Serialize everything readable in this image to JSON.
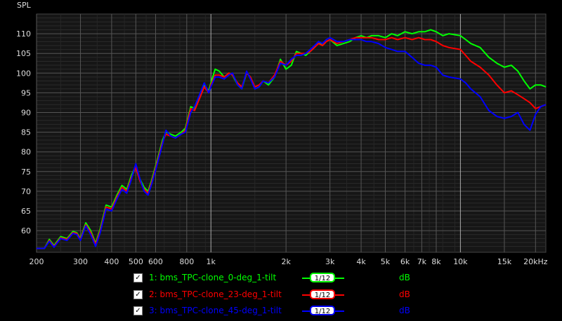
{
  "chart_data": {
    "type": "line",
    "ylabel": "SPL",
    "xlabel": "",
    "xscale": "log",
    "xlim": [
      200,
      22000
    ],
    "ylim": [
      54.5,
      115
    ],
    "yticks": [
      60,
      65,
      70,
      75,
      80,
      85,
      90,
      95,
      100,
      105,
      110
    ],
    "xticks": [
      {
        "v": 200,
        "label": "200"
      },
      {
        "v": 300,
        "label": "300"
      },
      {
        "v": 400,
        "label": "400"
      },
      {
        "v": 500,
        "label": "500"
      },
      {
        "v": 600,
        "label": "600"
      },
      {
        "v": 800,
        "label": "800"
      },
      {
        "v": 1000,
        "label": "1k"
      },
      {
        "v": 2000,
        "label": "2k"
      },
      {
        "v": 3000,
        "label": "3k"
      },
      {
        "v": 4000,
        "label": "4k"
      },
      {
        "v": 5000,
        "label": "5k"
      },
      {
        "v": 6000,
        "label": "6k"
      },
      {
        "v": 7000,
        "label": "7k"
      },
      {
        "v": 8000,
        "label": "8k"
      },
      {
        "v": 10000,
        "label": "10k"
      },
      {
        "v": 15000,
        "label": "15k"
      },
      {
        "v": 20000,
        "label": "20kHz"
      }
    ],
    "grid": true,
    "series": [
      {
        "name": "1: bms_TPC-clone_0-deg_1-tilt",
        "color": "#00ff00",
        "points": [
          [
            200,
            55.5
          ],
          [
            215,
            55.5
          ],
          [
            225,
            57.8
          ],
          [
            235,
            56.2
          ],
          [
            250,
            58.5
          ],
          [
            265,
            58.0
          ],
          [
            280,
            59.8
          ],
          [
            290,
            59.5
          ],
          [
            300,
            58.0
          ],
          [
            315,
            62.0
          ],
          [
            330,
            60.0
          ],
          [
            345,
            56.8
          ],
          [
            360,
            60.5
          ],
          [
            380,
            66.5
          ],
          [
            400,
            66.0
          ],
          [
            420,
            69.0
          ],
          [
            440,
            71.5
          ],
          [
            460,
            70.5
          ],
          [
            480,
            74.0
          ],
          [
            500,
            76.5
          ],
          [
            520,
            73.0
          ],
          [
            540,
            71.0
          ],
          [
            560,
            70.0
          ],
          [
            580,
            73.0
          ],
          [
            610,
            78.0
          ],
          [
            640,
            83.0
          ],
          [
            660,
            85.0
          ],
          [
            690,
            84.5
          ],
          [
            720,
            84.0
          ],
          [
            760,
            85.0
          ],
          [
            790,
            86.0
          ],
          [
            830,
            91.5
          ],
          [
            860,
            91.0
          ],
          [
            900,
            94.0
          ],
          [
            940,
            97.0
          ],
          [
            980,
            95.5
          ],
          [
            1000,
            97.5
          ],
          [
            1040,
            101.0
          ],
          [
            1080,
            100.5
          ],
          [
            1130,
            99.0
          ],
          [
            1180,
            100.0
          ],
          [
            1220,
            99.5
          ],
          [
            1280,
            97.0
          ],
          [
            1330,
            96.0
          ],
          [
            1390,
            100.0
          ],
          [
            1440,
            99.0
          ],
          [
            1500,
            96.0
          ],
          [
            1560,
            96.5
          ],
          [
            1620,
            98.0
          ],
          [
            1700,
            97.0
          ],
          [
            1800,
            99.0
          ],
          [
            1900,
            103.5
          ],
          [
            2000,
            101.0
          ],
          [
            2100,
            102.0
          ],
          [
            2200,
            105.5
          ],
          [
            2300,
            105.0
          ],
          [
            2400,
            104.5
          ],
          [
            2500,
            105.5
          ],
          [
            2600,
            106.5
          ],
          [
            2700,
            108.0
          ],
          [
            2800,
            107.0
          ],
          [
            2900,
            108.0
          ],
          [
            3000,
            108.5
          ],
          [
            3200,
            107.0
          ],
          [
            3400,
            107.5
          ],
          [
            3600,
            108.0
          ],
          [
            3800,
            109.0
          ],
          [
            4000,
            109.5
          ],
          [
            4200,
            109.0
          ],
          [
            4400,
            109.5
          ],
          [
            4700,
            109.5
          ],
          [
            5000,
            109.0
          ],
          [
            5300,
            110.0
          ],
          [
            5600,
            109.5
          ],
          [
            6000,
            110.5
          ],
          [
            6400,
            110.0
          ],
          [
            6800,
            110.5
          ],
          [
            7200,
            110.5
          ],
          [
            7600,
            111.0
          ],
          [
            8000,
            110.5
          ],
          [
            8500,
            109.5
          ],
          [
            9000,
            110.0
          ],
          [
            10000,
            109.5
          ],
          [
            10500,
            108.5
          ],
          [
            11000,
            107.5
          ],
          [
            12000,
            106.5
          ],
          [
            13000,
            104.0
          ],
          [
            14000,
            102.5
          ],
          [
            15000,
            101.5
          ],
          [
            16000,
            102.0
          ],
          [
            17000,
            100.5
          ],
          [
            18000,
            98.0
          ],
          [
            19000,
            96.0
          ],
          [
            20000,
            97.0
          ],
          [
            21000,
            97.0
          ],
          [
            22000,
            96.5
          ]
        ]
      },
      {
        "name": "2: bms_TPC-clone_23-deg_1-tilt",
        "color": "#ff0000",
        "points": [
          [
            200,
            55.5
          ],
          [
            215,
            55.5
          ],
          [
            225,
            57.5
          ],
          [
            235,
            56.0
          ],
          [
            250,
            58.2
          ],
          [
            265,
            57.8
          ],
          [
            280,
            59.5
          ],
          [
            290,
            59.3
          ],
          [
            300,
            57.8
          ],
          [
            315,
            61.5
          ],
          [
            330,
            59.5
          ],
          [
            345,
            56.5
          ],
          [
            360,
            60.0
          ],
          [
            380,
            66.0
          ],
          [
            400,
            65.5
          ],
          [
            420,
            68.5
          ],
          [
            440,
            71.0
          ],
          [
            460,
            70.0
          ],
          [
            480,
            73.5
          ],
          [
            500,
            76.0
          ],
          [
            520,
            72.5
          ],
          [
            540,
            70.5
          ],
          [
            560,
            69.5
          ],
          [
            580,
            72.5
          ],
          [
            610,
            77.5
          ],
          [
            640,
            82.5
          ],
          [
            660,
            84.5
          ],
          [
            690,
            84.0
          ],
          [
            720,
            83.5
          ],
          [
            760,
            84.5
          ],
          [
            790,
            85.5
          ],
          [
            830,
            91.0
          ],
          [
            860,
            90.5
          ],
          [
            900,
            93.5
          ],
          [
            940,
            96.5
          ],
          [
            980,
            95.0
          ],
          [
            1000,
            97.0
          ],
          [
            1040,
            99.5
          ],
          [
            1080,
            99.5
          ],
          [
            1130,
            99.0
          ],
          [
            1180,
            100.0
          ],
          [
            1220,
            99.5
          ],
          [
            1280,
            97.5
          ],
          [
            1330,
            96.5
          ],
          [
            1390,
            100.0
          ],
          [
            1440,
            99.0
          ],
          [
            1500,
            96.5
          ],
          [
            1560,
            97.0
          ],
          [
            1620,
            98.0
          ],
          [
            1700,
            97.5
          ],
          [
            1800,
            99.5
          ],
          [
            1900,
            103.0
          ],
          [
            2000,
            102.0
          ],
          [
            2100,
            103.0
          ],
          [
            2200,
            105.0
          ],
          [
            2300,
            105.0
          ],
          [
            2400,
            105.0
          ],
          [
            2500,
            105.5
          ],
          [
            2600,
            106.5
          ],
          [
            2700,
            107.5
          ],
          [
            2800,
            107.0
          ],
          [
            2900,
            108.0
          ],
          [
            3000,
            108.5
          ],
          [
            3200,
            107.5
          ],
          [
            3400,
            108.0
          ],
          [
            3600,
            108.5
          ],
          [
            3800,
            109.0
          ],
          [
            4000,
            109.0
          ],
          [
            4200,
            109.0
          ],
          [
            4400,
            109.0
          ],
          [
            4700,
            108.5
          ],
          [
            5000,
            108.5
          ],
          [
            5300,
            109.0
          ],
          [
            5600,
            108.5
          ],
          [
            6000,
            109.0
          ],
          [
            6400,
            108.5
          ],
          [
            6800,
            109.0
          ],
          [
            7200,
            108.5
          ],
          [
            7600,
            108.5
          ],
          [
            8000,
            108.0
          ],
          [
            8500,
            107.0
          ],
          [
            9000,
            106.5
          ],
          [
            10000,
            106.0
          ],
          [
            10500,
            104.5
          ],
          [
            11000,
            103.0
          ],
          [
            12000,
            101.5
          ],
          [
            13000,
            99.5
          ],
          [
            14000,
            97.0
          ],
          [
            15000,
            95.0
          ],
          [
            16000,
            95.5
          ],
          [
            17000,
            94.5
          ],
          [
            18000,
            93.5
          ],
          [
            19000,
            92.5
          ],
          [
            20000,
            91.0
          ],
          [
            21000,
            91.5
          ],
          [
            22000,
            92.0
          ]
        ]
      },
      {
        "name": "3: bms_TPC-clone_45-deg_1-tilt",
        "color": "#0000ff",
        "points": [
          [
            200,
            55.5
          ],
          [
            215,
            55.5
          ],
          [
            225,
            57.3
          ],
          [
            235,
            55.8
          ],
          [
            250,
            58.0
          ],
          [
            265,
            57.5
          ],
          [
            280,
            59.3
          ],
          [
            290,
            59.0
          ],
          [
            300,
            57.5
          ],
          [
            315,
            61.2
          ],
          [
            330,
            59.0
          ],
          [
            345,
            56.0
          ],
          [
            360,
            59.5
          ],
          [
            380,
            65.5
          ],
          [
            400,
            65.0
          ],
          [
            420,
            68.0
          ],
          [
            440,
            70.5
          ],
          [
            460,
            69.5
          ],
          [
            480,
            73.0
          ],
          [
            500,
            77.0
          ],
          [
            520,
            73.0
          ],
          [
            540,
            70.0
          ],
          [
            560,
            69.0
          ],
          [
            580,
            72.0
          ],
          [
            610,
            77.0
          ],
          [
            640,
            82.0
          ],
          [
            660,
            85.5
          ],
          [
            690,
            84.0
          ],
          [
            720,
            83.5
          ],
          [
            760,
            84.5
          ],
          [
            790,
            85.0
          ],
          [
            830,
            90.0
          ],
          [
            860,
            91.5
          ],
          [
            900,
            94.5
          ],
          [
            940,
            97.5
          ],
          [
            980,
            95.0
          ],
          [
            1000,
            96.5
          ],
          [
            1040,
            99.0
          ],
          [
            1080,
            99.0
          ],
          [
            1130,
            98.5
          ],
          [
            1180,
            99.5
          ],
          [
            1220,
            100.0
          ],
          [
            1280,
            97.0
          ],
          [
            1330,
            96.0
          ],
          [
            1390,
            100.5
          ],
          [
            1440,
            98.5
          ],
          [
            1500,
            96.0
          ],
          [
            1560,
            96.5
          ],
          [
            1620,
            98.0
          ],
          [
            1700,
            97.5
          ],
          [
            1800,
            99.0
          ],
          [
            1900,
            102.5
          ],
          [
            2000,
            102.0
          ],
          [
            2100,
            103.5
          ],
          [
            2200,
            104.5
          ],
          [
            2300,
            104.5
          ],
          [
            2400,
            105.0
          ],
          [
            2500,
            106.0
          ],
          [
            2600,
            107.0
          ],
          [
            2700,
            108.0
          ],
          [
            2800,
            107.5
          ],
          [
            2900,
            108.5
          ],
          [
            3000,
            109.0
          ],
          [
            3200,
            108.0
          ],
          [
            3400,
            108.0
          ],
          [
            3600,
            108.5
          ],
          [
            3800,
            108.5
          ],
          [
            4000,
            108.5
          ],
          [
            4200,
            108.0
          ],
          [
            4400,
            108.0
          ],
          [
            4700,
            107.5
          ],
          [
            5000,
            106.5
          ],
          [
            5300,
            106.0
          ],
          [
            5600,
            105.5
          ],
          [
            6000,
            105.5
          ],
          [
            6400,
            104.0
          ],
          [
            6800,
            102.5
          ],
          [
            7200,
            102.0
          ],
          [
            7600,
            102.0
          ],
          [
            8000,
            101.5
          ],
          [
            8500,
            99.5
          ],
          [
            9000,
            99.0
          ],
          [
            10000,
            98.5
          ],
          [
            10500,
            97.5
          ],
          [
            11000,
            96.0
          ],
          [
            12000,
            94.0
          ],
          [
            13000,
            90.5
          ],
          [
            14000,
            89.0
          ],
          [
            15000,
            88.5
          ],
          [
            16000,
            89.0
          ],
          [
            17000,
            90.0
          ],
          [
            18000,
            87.0
          ],
          [
            19000,
            85.5
          ],
          [
            20000,
            89.5
          ],
          [
            21000,
            91.5
          ],
          [
            22000,
            92.0
          ]
        ]
      }
    ]
  },
  "legend": [
    {
      "checkbox": "✓",
      "label": "1: bms_TPC-clone_0-deg_1-tilt",
      "color": "#00ff00",
      "smoothing": "1/12",
      "unit": "dB"
    },
    {
      "checkbox": "✓",
      "label": "2: bms_TPC-clone_23-deg_1-tilt",
      "color": "#ff0000",
      "smoothing": "1/12",
      "unit": "dB"
    },
    {
      "checkbox": "✓",
      "label": "3: bms_TPC-clone_45-deg_1-tilt",
      "color": "#0000ff",
      "smoothing": "1/12",
      "unit": "dB"
    }
  ]
}
